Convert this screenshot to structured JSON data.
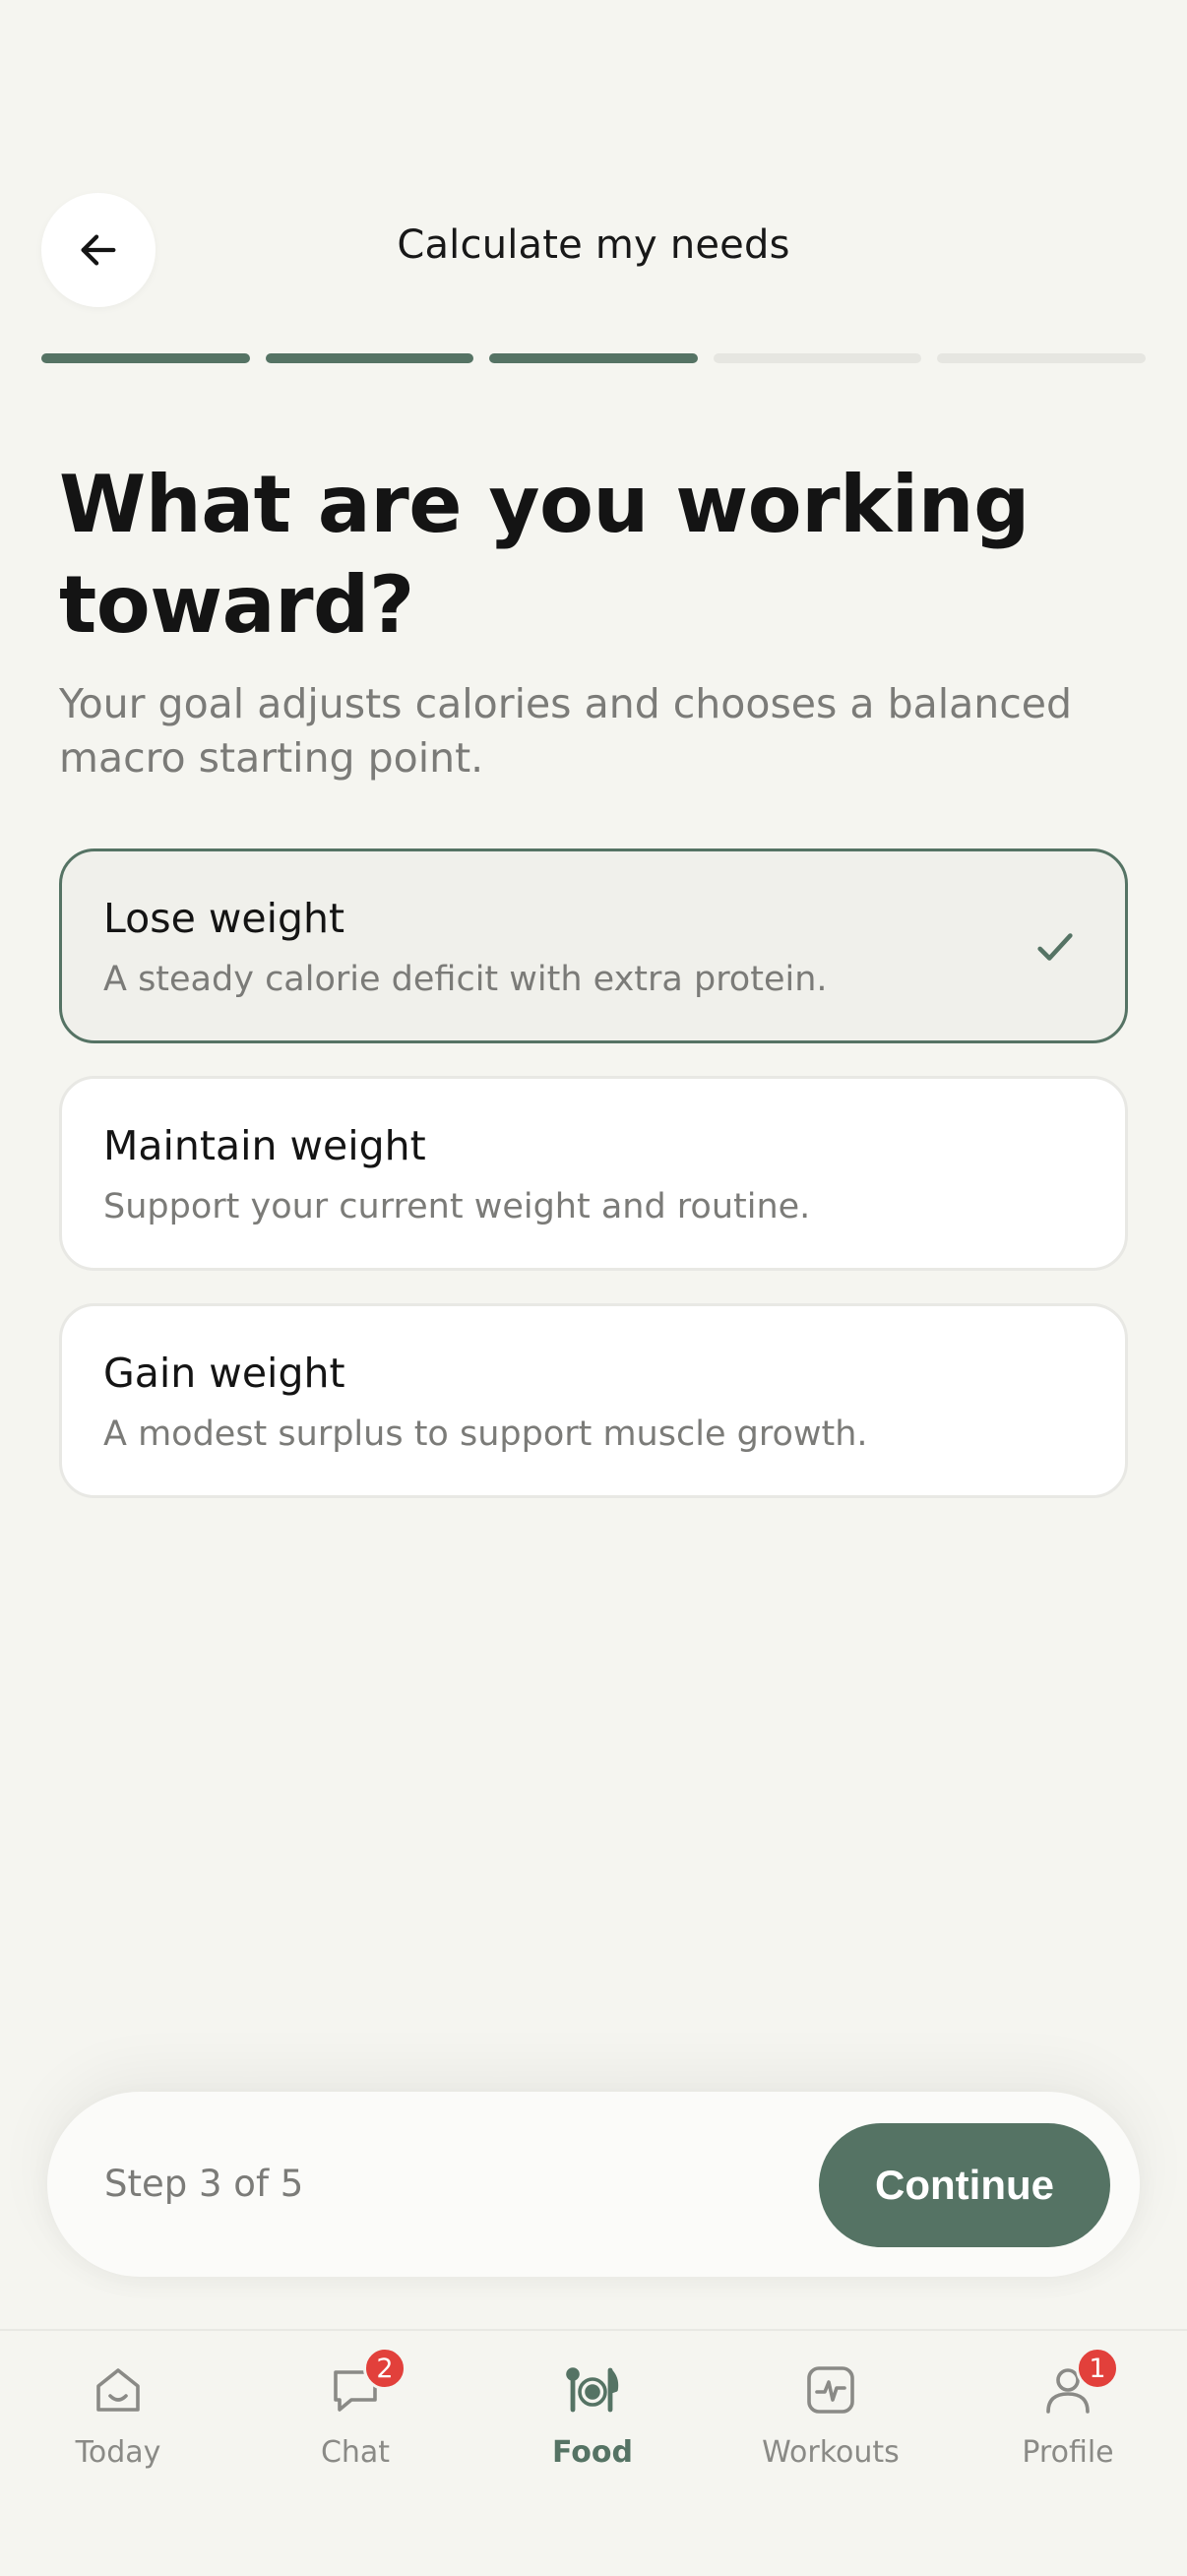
{
  "header": {
    "title": "Calculate my needs",
    "back_icon": "arrow-left-icon"
  },
  "progress": {
    "total_steps": 5,
    "completed_steps": 3
  },
  "question": {
    "title": "What are you working toward?",
    "subtitle": "Your goal adjusts calories and chooses a balanced macro starting point."
  },
  "options": [
    {
      "title": "Lose weight",
      "description": "A steady calorie deficit with extra protein.",
      "selected": true
    },
    {
      "title": "Maintain weight",
      "description": "Support your current weight and routine.",
      "selected": false
    },
    {
      "title": "Gain weight",
      "description": "A modest surplus to support muscle growth.",
      "selected": false
    }
  ],
  "footer": {
    "step_text": "Step 3 of 5",
    "continue_label": "Continue"
  },
  "tabbar": {
    "items": [
      {
        "label": "Today",
        "icon": "home-icon",
        "badge": ""
      },
      {
        "label": "Chat",
        "icon": "chat-icon",
        "badge": "2"
      },
      {
        "label": "Food",
        "icon": "food-icon",
        "badge": "",
        "active": true
      },
      {
        "label": "Workouts",
        "icon": "activity-icon",
        "badge": ""
      },
      {
        "label": "Profile",
        "icon": "profile-icon",
        "badge": "1"
      }
    ]
  },
  "colors": {
    "accent": "#557364",
    "background": "#f5f5f0",
    "badge": "#e2403b"
  }
}
